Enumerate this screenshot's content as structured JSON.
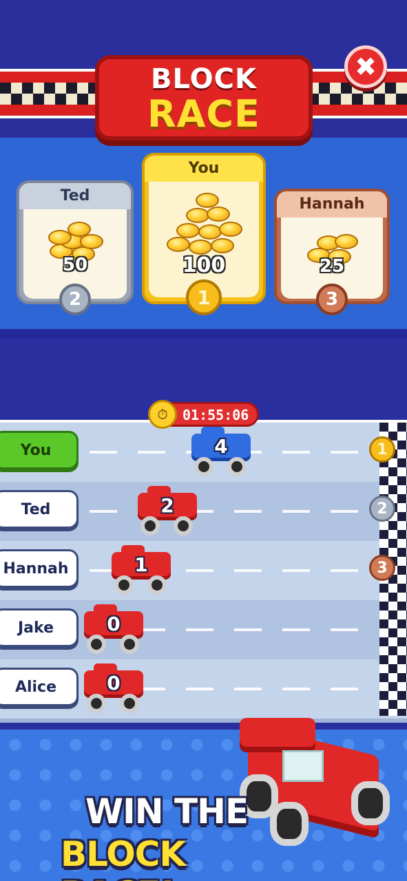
{
  "header": {
    "title_line1": "BLOCK",
    "title_line2": "RACE",
    "close_icon": "x-icon"
  },
  "podium": [
    {
      "name": "Ted",
      "coins": "50",
      "rank": "2",
      "medal": "silver"
    },
    {
      "name": "You",
      "coins": "100",
      "rank": "1",
      "medal": "gold"
    },
    {
      "name": "Hannah",
      "coins": "25",
      "rank": "3",
      "medal": "bronze"
    }
  ],
  "timer": {
    "value": "01:55:06",
    "icon": "stopwatch-icon"
  },
  "lanes": [
    {
      "name": "You",
      "score": "4",
      "car_color": "blue",
      "medal_rank": "1",
      "medal": "gold"
    },
    {
      "name": "Ted",
      "score": "2",
      "car_color": "red",
      "medal_rank": "2",
      "medal": "silver"
    },
    {
      "name": "Hannah",
      "score": "1",
      "car_color": "red",
      "medal_rank": "3",
      "medal": "bronze"
    },
    {
      "name": "Jake",
      "score": "0",
      "car_color": "red",
      "medal_rank": "",
      "medal": ""
    },
    {
      "name": "Alice",
      "score": "0",
      "car_color": "red",
      "medal_rank": "",
      "medal": ""
    }
  ],
  "banner": {
    "line1": "WIN THE",
    "line2": "BLOCK RACE!"
  },
  "colors": {
    "accent_red": "#e02424",
    "accent_yellow": "#ffe033",
    "you_green": "#5bc82a",
    "background_blue": "#2a2fa0"
  }
}
